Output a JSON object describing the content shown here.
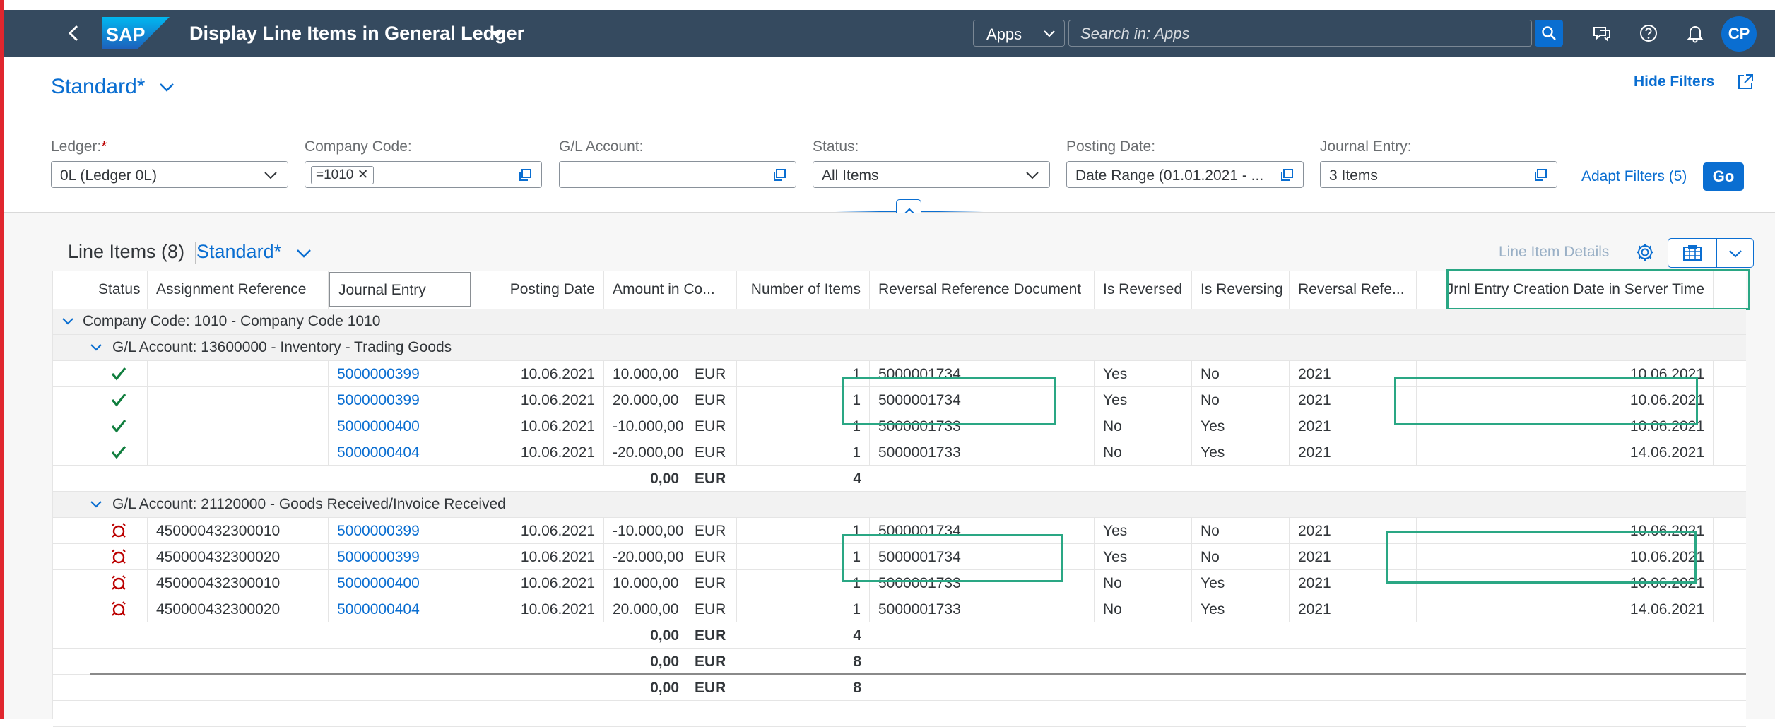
{
  "shell": {
    "app_title": "Display Line Items in General Ledger",
    "scope": "Apps",
    "search_placeholder": "Search in: Apps",
    "avatar": "CP",
    "logo_text": "SAP"
  },
  "header": {
    "variant": "Standard*",
    "hide_filters": "Hide Filters",
    "filters": [
      {
        "label": "Ledger:",
        "required": "*",
        "value": "0L (Ledger 0L)",
        "kind": "dropdown"
      },
      {
        "label": "Company Code:",
        "token": "=1010",
        "kind": "valuehelp"
      },
      {
        "label": "G/L Account:",
        "value": "",
        "kind": "valuehelp"
      },
      {
        "label": "Status:",
        "value": "All Items",
        "kind": "dropdown"
      },
      {
        "label": "Posting Date:",
        "value": "Date Range (01.01.2021 - ...",
        "kind": "valuehelp"
      },
      {
        "label": "Journal Entry:",
        "value": "3 Items",
        "kind": "valuehelp"
      }
    ],
    "adapt_filters": "Adapt Filters (5)",
    "go": "Go"
  },
  "table": {
    "title": "Line Items (8)",
    "variant": "Standard*",
    "line_item_details": "Line Item Details",
    "columns": [
      "Status",
      "Assignment Reference",
      "Journal Entry",
      "Posting Date",
      "Amount in Co...",
      "Number of Items",
      "Reversal Reference Document",
      "Is Reversed",
      "Is Reversing",
      "Reversal Refe...",
      "Jrnl Entry Creation Date in Server Time"
    ],
    "company_group": "Company Code: 1010 - Company Code 1010",
    "groups": [
      {
        "title": "G/L Account: 13600000 - Inventory - Trading Goods",
        "status_icon": "check-icon",
        "rows": [
          {
            "assign": "",
            "je": "5000000399",
            "date": "10.06.2021",
            "amount": "10.000,00",
            "cur": "EUR",
            "num": "1",
            "revdoc": "5000001734",
            "isrev": "Yes",
            "isrevg": "No",
            "revref": "2021",
            "created": "10.06.2021"
          },
          {
            "assign": "",
            "je": "5000000399",
            "date": "10.06.2021",
            "amount": "20.000,00",
            "cur": "EUR",
            "num": "1",
            "revdoc": "5000001734",
            "isrev": "Yes",
            "isrevg": "No",
            "revref": "2021",
            "created": "10.06.2021"
          },
          {
            "assign": "",
            "je": "5000000400",
            "date": "10.06.2021",
            "amount": "-10.000,00",
            "cur": "EUR",
            "num": "1",
            "revdoc": "5000001733",
            "isrev": "No",
            "isrevg": "Yes",
            "revref": "2021",
            "created": "10.06.2021"
          },
          {
            "assign": "",
            "je": "5000000404",
            "date": "10.06.2021",
            "amount": "-20.000,00",
            "cur": "EUR",
            "num": "1",
            "revdoc": "5000001733",
            "isrev": "No",
            "isrevg": "Yes",
            "revref": "2021",
            "created": "14.06.2021"
          }
        ],
        "subtotal": {
          "amount": "0,00",
          "cur": "EUR",
          "num": "4"
        }
      },
      {
        "title": "G/L Account: 21120000 - Goods Received/Invoice Received",
        "status_icon": "open-item-icon",
        "rows": [
          {
            "assign": "450000432300010",
            "je": "5000000399",
            "date": "10.06.2021",
            "amount": "-10.000,00",
            "cur": "EUR",
            "num": "1",
            "revdoc": "5000001734",
            "isrev": "Yes",
            "isrevg": "No",
            "revref": "2021",
            "created": "10.06.2021"
          },
          {
            "assign": "450000432300020",
            "je": "5000000399",
            "date": "10.06.2021",
            "amount": "-20.000,00",
            "cur": "EUR",
            "num": "1",
            "revdoc": "5000001734",
            "isrev": "Yes",
            "isrevg": "No",
            "revref": "2021",
            "created": "10.06.2021"
          },
          {
            "assign": "450000432300010",
            "je": "5000000400",
            "date": "10.06.2021",
            "amount": "10.000,00",
            "cur": "EUR",
            "num": "1",
            "revdoc": "5000001733",
            "isrev": "No",
            "isrevg": "Yes",
            "revref": "2021",
            "created": "10.06.2021"
          },
          {
            "assign": "450000432300020",
            "je": "5000000404",
            "date": "10.06.2021",
            "amount": "20.000,00",
            "cur": "EUR",
            "num": "1",
            "revdoc": "5000001733",
            "isrev": "No",
            "isrevg": "Yes",
            "revref": "2021",
            "created": "14.06.2021"
          }
        ],
        "subtotal": {
          "amount": "0,00",
          "cur": "EUR",
          "num": "4"
        }
      }
    ],
    "company_total": {
      "amount": "0,00",
      "cur": "EUR",
      "num": "8"
    },
    "grand_total": {
      "amount": "0,00",
      "cur": "EUR",
      "num": "8"
    }
  },
  "colors": {
    "shell": "#354a5f",
    "accent": "#0a6ed1",
    "highlight": "#2aa784",
    "check": "#107e3e",
    "open": "#bb0000"
  }
}
